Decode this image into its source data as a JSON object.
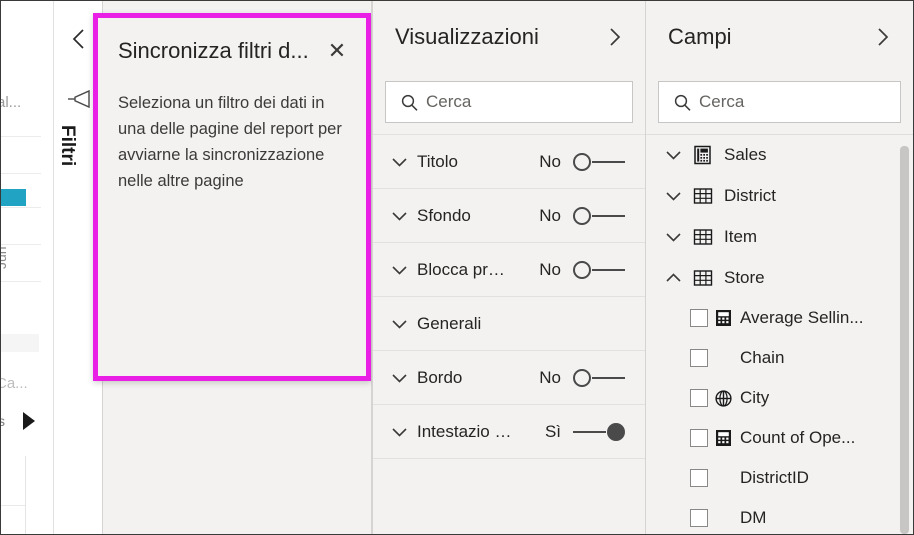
{
  "report_sliver": {
    "axis_label": "al...",
    "rot_label": "Jun",
    "ca_label": "Ca...",
    "s_label": "s",
    "bar_color": "#21a3c4"
  },
  "filters_rail": {
    "collapse_icon": "chevron-left-icon",
    "filter_icon": "funnel-icon",
    "title": "Filtri"
  },
  "sync_callout": {
    "title": "Sincronizza filtri d...",
    "close_label": "✕",
    "body": "Seleziona un filtro dei dati in una delle pagine del report per avviarne la sincronizzazione nelle altre pagine",
    "highlight_color": "#ea1fe6"
  },
  "visualizations": {
    "title": "Visualizzazioni",
    "expand_icon": "chevron-right-icon",
    "search": {
      "placeholder": "Cerca",
      "value": "",
      "icon": "search-icon"
    },
    "format_rows": [
      {
        "label": "Titolo",
        "state": "No",
        "toggle": "off"
      },
      {
        "label": "Sfondo",
        "state": "No",
        "toggle": "off"
      },
      {
        "label": "Blocca pr…",
        "state": "No",
        "toggle": "off"
      },
      {
        "label": "Generali",
        "state": "",
        "toggle": "none"
      },
      {
        "label": "Bordo",
        "state": "No",
        "toggle": "off"
      },
      {
        "label": "Intestazio …",
        "state": "Sì",
        "toggle": "on"
      }
    ]
  },
  "fields": {
    "title": "Campi",
    "expand_icon": "chevron-right-icon",
    "search": {
      "placeholder": "Cerca",
      "value": "",
      "icon": "search-icon"
    },
    "groups": [
      {
        "label": "Sales",
        "icon": "measure-table-icon",
        "chevron": "chevron-down-icon",
        "expanded": false
      },
      {
        "label": "District",
        "icon": "table-icon",
        "chevron": "chevron-down-icon",
        "expanded": false
      },
      {
        "label": "Item",
        "icon": "table-icon",
        "chevron": "chevron-down-icon",
        "expanded": false
      },
      {
        "label": "Store",
        "icon": "table-icon",
        "chevron": "chevron-up-icon",
        "expanded": true
      }
    ],
    "store_fields": [
      {
        "label": "Average Sellin...",
        "icon": "measure-icon",
        "checked": false
      },
      {
        "label": "Chain",
        "icon": "",
        "checked": false
      },
      {
        "label": "City",
        "icon": "globe-icon",
        "checked": false
      },
      {
        "label": "Count of Ope...",
        "icon": "measure-icon",
        "checked": false
      },
      {
        "label": "DistrictID",
        "icon": "",
        "checked": false
      },
      {
        "label": "DM",
        "icon": "",
        "checked": false
      }
    ]
  }
}
